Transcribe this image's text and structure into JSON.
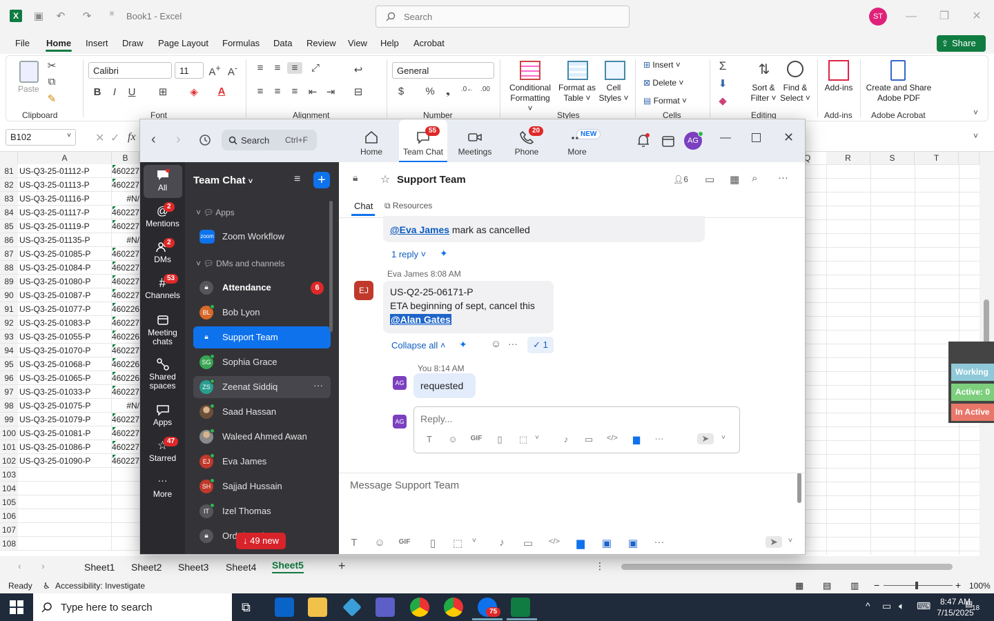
{
  "excel": {
    "doc_title": "Book1  -  Excel",
    "search_placeholder": "Search",
    "user_initials": "ST",
    "menu": [
      "File",
      "Home",
      "Insert",
      "Draw",
      "Page Layout",
      "Formulas",
      "Data",
      "Review",
      "View",
      "Help",
      "Acrobat"
    ],
    "share_label": "Share",
    "ribbon": {
      "paste": "Paste",
      "clipboard": "Clipboard",
      "font_name": "Calibri",
      "font_size": "11",
      "font": "Font",
      "alignment": "Alignment",
      "number_format": "General",
      "number": "Number",
      "conditional_formatting": [
        "Conditional",
        "Formatting"
      ],
      "format_as_table": [
        "Format as",
        "Table"
      ],
      "cell_styles": [
        "Cell",
        "Styles"
      ],
      "styles": "Styles",
      "insert": "Insert",
      "delete": "Delete",
      "format": "Format",
      "cells": "Cells",
      "sort_filter": [
        "Sort &",
        "Filter"
      ],
      "find_select": [
        "Find &",
        "Select"
      ],
      "editing": "Editing",
      "add_ins": "Add-ins",
      "add_ins_group": "Add-ins",
      "create_share": [
        "Create and Share",
        "Adobe PDF"
      ],
      "adobe_acrobat": "Adobe Acrobat",
      "bold": "B",
      "italic": "I",
      "underline": "U",
      "currency": "$",
      "percent": "%"
    },
    "name_box": "B102",
    "fx": "fx",
    "col_headers_left": [
      "A",
      "B"
    ],
    "col_headers_right": [
      "Q",
      "R",
      "S",
      "T"
    ],
    "rows": [
      {
        "n": "81",
        "a": "US-Q3-25-01112-P",
        "b": "460227"
      },
      {
        "n": "82",
        "a": "US-Q3-25-01113-P",
        "b": "460227"
      },
      {
        "n": "83",
        "a": "US-Q3-25-01116-P",
        "b": "#N/"
      },
      {
        "n": "84",
        "a": "US-Q3-25-01117-P",
        "b": "460227"
      },
      {
        "n": "85",
        "a": "US-Q3-25-01119-P",
        "b": "460227"
      },
      {
        "n": "86",
        "a": "US-Q3-25-01135-P",
        "b": "#N/"
      },
      {
        "n": "87",
        "a": "US-Q3-25-01085-P",
        "b": "460227"
      },
      {
        "n": "88",
        "a": "US-Q3-25-01084-P",
        "b": "460227"
      },
      {
        "n": "89",
        "a": "US-Q3-25-01080-P",
        "b": "460227"
      },
      {
        "n": "90",
        "a": "US-Q3-25-01087-P",
        "b": "460227"
      },
      {
        "n": "91",
        "a": "US-Q3-25-01077-P",
        "b": "460226"
      },
      {
        "n": "92",
        "a": "US-Q3-25-01083-P",
        "b": "460227"
      },
      {
        "n": "93",
        "a": "US-Q3-25-01055-P",
        "b": "460226"
      },
      {
        "n": "94",
        "a": "US-Q3-25-01070-P",
        "b": "460227"
      },
      {
        "n": "95",
        "a": "US-Q3-25-01068-P",
        "b": "460226"
      },
      {
        "n": "96",
        "a": "US-Q3-25-01065-P",
        "b": "460226"
      },
      {
        "n": "97",
        "a": "US-Q3-25-01033-P",
        "b": "460227"
      },
      {
        "n": "98",
        "a": "US-Q3-25-01075-P",
        "b": "#N/"
      },
      {
        "n": "99",
        "a": "US-Q3-25-01079-P",
        "b": "460227"
      },
      {
        "n": "100",
        "a": "US-Q3-25-01081-P",
        "b": "460227"
      },
      {
        "n": "101",
        "a": "US-Q3-25-01086-P",
        "b": "460227"
      },
      {
        "n": "102",
        "a": "US-Q3-25-01090-P",
        "b": "460227"
      },
      {
        "n": "103",
        "a": "",
        "b": ""
      },
      {
        "n": "104",
        "a": "",
        "b": ""
      },
      {
        "n": "105",
        "a": "",
        "b": ""
      },
      {
        "n": "106",
        "a": "",
        "b": ""
      },
      {
        "n": "107",
        "a": "",
        "b": ""
      },
      {
        "n": "108",
        "a": "",
        "b": ""
      }
    ],
    "status_widget": [
      {
        "label": "Working",
        "color": "#8fc9d9"
      },
      {
        "label": "Active: 0",
        "color": "#7dcf7d"
      },
      {
        "label": "In Active",
        "color": "#e8776a"
      }
    ],
    "sheets": [
      "Sheet1",
      "Sheet2",
      "Sheet3",
      "Sheet4",
      "Sheet5"
    ],
    "active_sheet": "Sheet5",
    "status_ready": "Ready",
    "status_accessibility": "Accessibility: Investigate",
    "zoom_level": "100%"
  },
  "taskbar": {
    "search_placeholder": "Type here to search",
    "time": "8:47 AM",
    "date": "7/15/2025",
    "notifications": "18",
    "zoom_badge": "75"
  },
  "zoom": {
    "search_label": "Search",
    "search_shortcut": "Ctrl+F",
    "nav_tabs": [
      {
        "label": "Home",
        "badge": ""
      },
      {
        "label": "Team Chat",
        "badge": "55"
      },
      {
        "label": "Meetings",
        "badge": ""
      },
      {
        "label": "Phone",
        "badge": "20"
      },
      {
        "label": "More",
        "badge": "NEW"
      }
    ],
    "user_initials": "AG",
    "rail": [
      {
        "label": "All",
        "badge": ""
      },
      {
        "label": "Mentions",
        "badge": "2"
      },
      {
        "label": "DMs",
        "badge": "2"
      },
      {
        "label": "Channels",
        "badge": "53"
      },
      {
        "label": "Meeting chats",
        "badge": ""
      },
      {
        "label": "Shared spaces",
        "badge": ""
      },
      {
        "label": "Apps",
        "badge": ""
      },
      {
        "label": "Starred",
        "badge": "47"
      },
      {
        "label": "More",
        "badge": ""
      }
    ],
    "sidebar_title": "Team Chat",
    "section_apps": "Apps",
    "section_dms": "DMs and channels",
    "new_badge": "49 new",
    "channels": [
      {
        "name": "Zoom Workflow",
        "initials": "zoom",
        "color": "#0e72ed",
        "type": "app",
        "badge": "",
        "bold": false
      },
      {
        "name": "Attendance",
        "initials": "",
        "color": "#55555a",
        "type": "lock",
        "badge": "6",
        "bold": true
      },
      {
        "name": "Bob Lyon",
        "initials": "BL",
        "color": "#d9692a",
        "type": "person",
        "badge": "",
        "bold": false
      },
      {
        "name": "Support Team",
        "initials": "",
        "color": "#ffffff",
        "type": "lock-active",
        "badge": "",
        "bold": false
      },
      {
        "name": "Sophia Grace",
        "initials": "SG",
        "color": "#3aa655",
        "type": "person",
        "badge": "",
        "bold": false
      },
      {
        "name": "Zeenat Siddiq",
        "initials": "ZS",
        "color": "#2a9d8f",
        "type": "person",
        "badge": "",
        "bold": false
      },
      {
        "name": "Saad Hassan",
        "initials": "",
        "color": "#6b4f3a",
        "type": "photo",
        "badge": "",
        "bold": false
      },
      {
        "name": "Waleed Ahmed Awan",
        "initials": "",
        "color": "#8a8a8a",
        "type": "photo",
        "badge": "",
        "bold": false
      },
      {
        "name": "Eva James",
        "initials": "EJ",
        "color": "#c0392b",
        "type": "person",
        "badge": "",
        "bold": false
      },
      {
        "name": "Sajjad Hussain",
        "initials": "SH",
        "color": "#c0392b",
        "type": "person",
        "badge": "",
        "bold": false
      },
      {
        "name": "Izel Thomas",
        "initials": "IT",
        "color": "#55555a",
        "type": "person",
        "badge": "",
        "bold": false
      },
      {
        "name": "Ord           d Quries",
        "initials": "",
        "color": "#55555a",
        "type": "lock",
        "badge": "",
        "bold": false
      }
    ],
    "chat": {
      "channel_name": "Support Team",
      "member_count": "6",
      "tab_chat": "Chat",
      "tab_resources": "Resources",
      "prev_msg_mention": "@Eva James",
      "prev_msg_text": " mark as cancelled",
      "reply_link": "1 reply",
      "msg_author_time": "Eva James 8:08 AM",
      "msg_avatar": "EJ",
      "msg_line1": "US-Q2-25-06171-P",
      "msg_line2": "ETA beginning of sept, cancel this",
      "msg_mention": "@Alan Gates",
      "collapse_all": "Collapse all",
      "reaction_count": "1",
      "reply_author_time": "You 8:14 AM",
      "reply_avatar": "AG",
      "reply_text": "requested",
      "reply_placeholder": "Reply...",
      "composer_placeholder": "Message Support Team"
    }
  }
}
